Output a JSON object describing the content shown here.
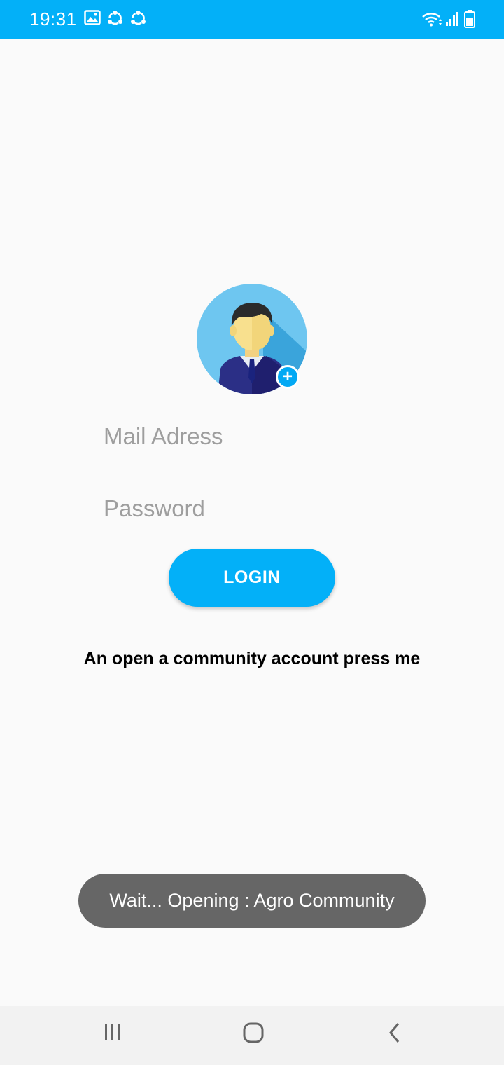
{
  "status_bar": {
    "time": "19:31",
    "icons": [
      "image-icon",
      "sync-icon",
      "sync-icon",
      "wifi-icon",
      "signal-icon",
      "battery-icon"
    ],
    "background": "#03b0f8"
  },
  "avatar": {
    "description_icon": "user-avatar-icon",
    "badge_icon": "add-icon",
    "badge_symbol": "+"
  },
  "form": {
    "mail_placeholder": "Mail Adress",
    "mail_value": "",
    "password_placeholder": "Password",
    "password_value": ""
  },
  "login_button": {
    "label": "LOGIN",
    "color": "#03b0f8"
  },
  "register_link": {
    "label": "An open a community account press me"
  },
  "toast": {
    "message": "Wait... Opening : Agro Community"
  },
  "nav_bar": {
    "icons": [
      "recent-apps-icon",
      "home-icon",
      "back-icon"
    ]
  }
}
